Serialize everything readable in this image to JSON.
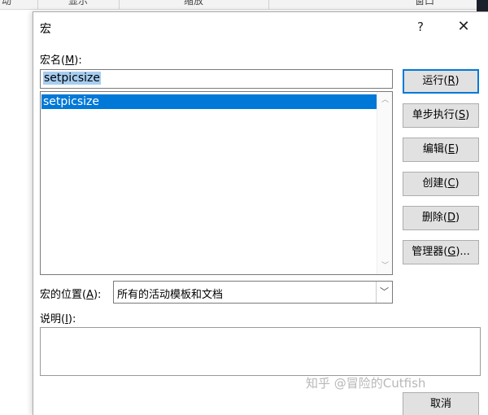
{
  "background": {
    "ribbon_labels": [
      "动",
      "显示",
      "缩放",
      "窗口"
    ]
  },
  "dialog": {
    "title": "宏",
    "help_label": "?",
    "close_label": "✕",
    "macro_name_label_pre": "宏名(",
    "macro_name_label_key": "M",
    "macro_name_label_post": "):",
    "macro_name_value": "setpicsize",
    "macro_list": [
      "setpicsize"
    ],
    "scroll_up_glyph": "︿",
    "scroll_down_glyph": "﹀",
    "location_label_pre": "宏的位置(",
    "location_label_key": "A",
    "location_label_post": "):",
    "location_value": "所有的活动模板和文档",
    "location_arrow": "﹀",
    "description_label_pre": "说明(",
    "description_label_key": "I",
    "description_label_post": "):",
    "description_value": "",
    "buttons": {
      "run": {
        "pre": "运行(",
        "key": "R",
        "post": ")"
      },
      "step": {
        "pre": "单步执行(",
        "key": "S",
        "post": ")"
      },
      "edit": {
        "pre": "编辑(",
        "key": "E",
        "post": ")"
      },
      "create": {
        "pre": "创建(",
        "key": "C",
        "post": ")"
      },
      "delete": {
        "pre": "删除(",
        "key": "D",
        "post": ")"
      },
      "organizer": {
        "pre": "管理器(",
        "key": "G",
        "post": ")..."
      },
      "cancel": {
        "label": "取消"
      }
    }
  },
  "watermark": "知乎 @冒险的Cutfish",
  "colors": {
    "selection": "#0078d7",
    "name_highlight": "#a6cdf0",
    "button_face": "#e1e1e1"
  }
}
